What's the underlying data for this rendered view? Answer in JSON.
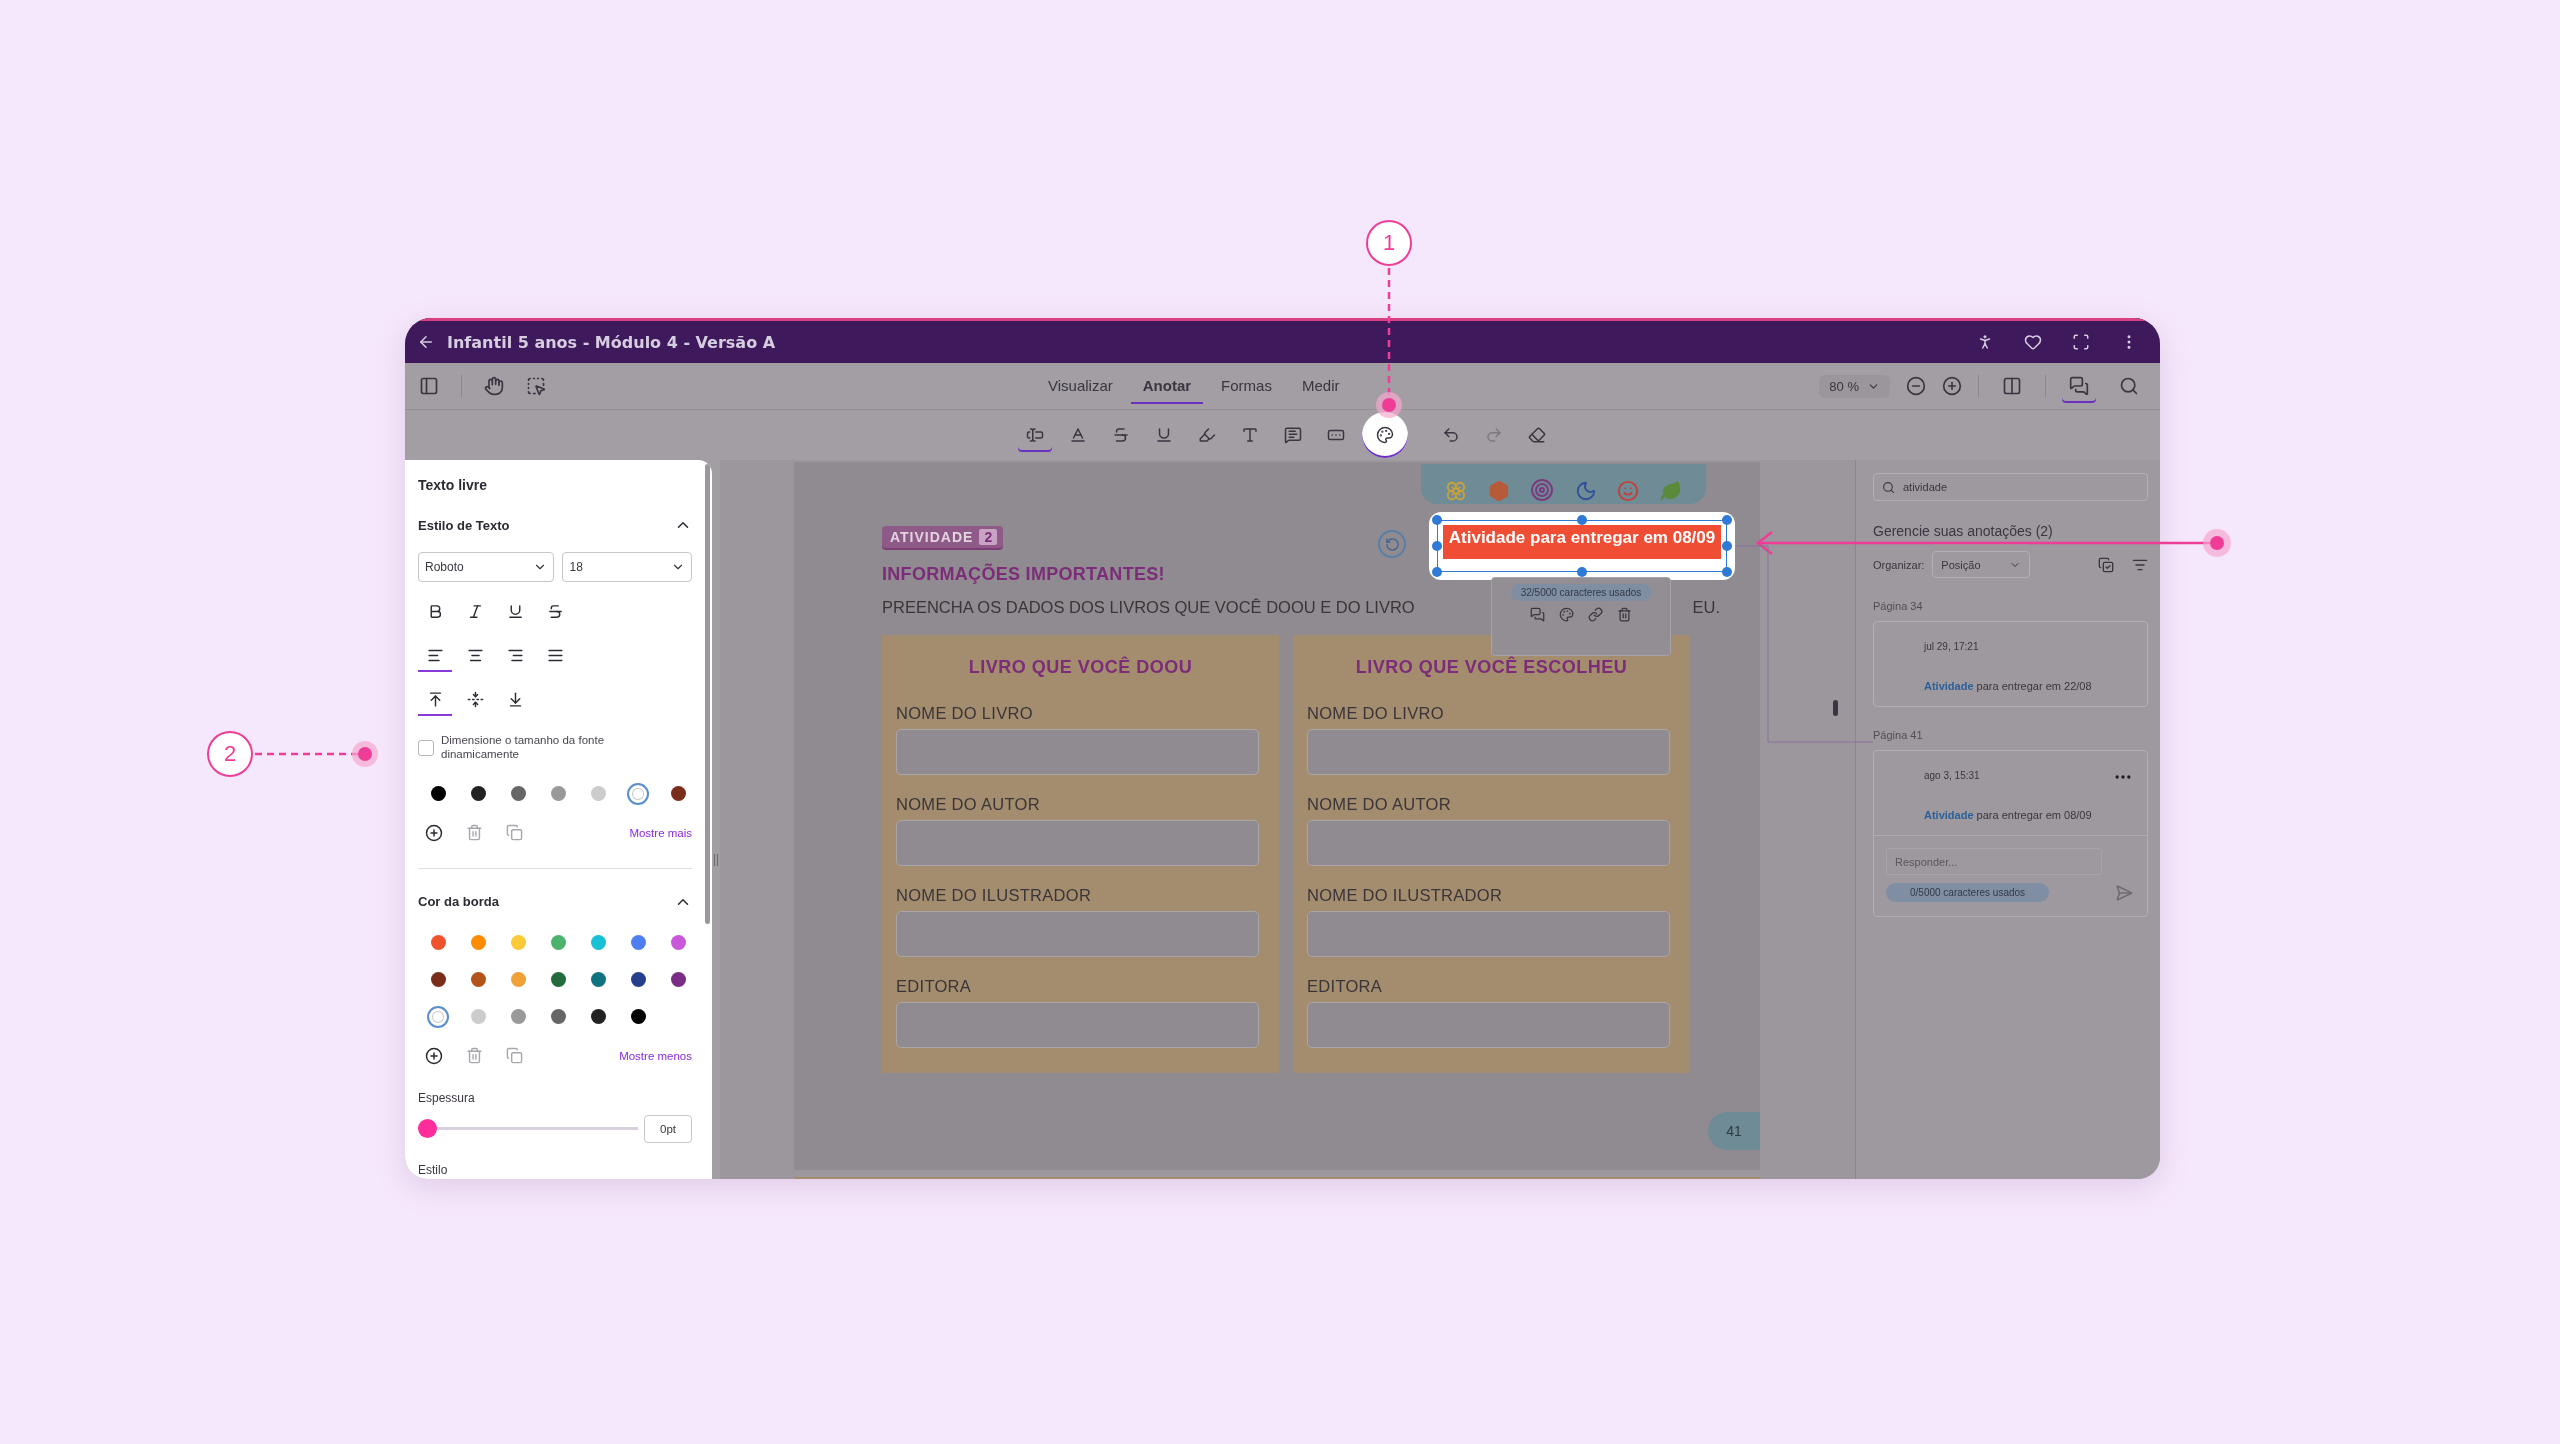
{
  "window": {
    "title": "Infantil 5 anos - Módulo 4 - Versão A"
  },
  "tabs": [
    {
      "label": "Visualizar",
      "selected": false
    },
    {
      "label": "Anotar",
      "selected": true
    },
    {
      "label": "Formas",
      "selected": false
    },
    {
      "label": "Medir",
      "selected": false
    }
  ],
  "zoom": "80 %",
  "view_buttons": [
    {
      "selected": false
    },
    {
      "selected": true
    },
    {
      "selected": false
    }
  ],
  "annotation_tools": [
    {
      "selected": true,
      "highlighted": false
    },
    {
      "selected": false,
      "highlighted": false
    },
    {
      "selected": false,
      "highlighted": false
    },
    {
      "selected": false,
      "highlighted": false
    },
    {
      "selected": false,
      "highlighted": false
    },
    {
      "selected": false,
      "highlighted": false
    },
    {
      "selected": false,
      "highlighted": false
    },
    {
      "selected": false,
      "highlighted": false
    },
    {
      "selected": true,
      "highlighted": true
    }
  ],
  "history": [
    {
      "disabled": false
    },
    {
      "disabled": true
    }
  ],
  "text_panel": {
    "title": "Texto livre",
    "text_style": {
      "title": "Estilo de Texto",
      "expanded": true,
      "font": "Roboto",
      "size": "18",
      "alignments": [
        {
          "selected": true
        },
        {
          "selected": false
        },
        {
          "selected": false
        },
        {
          "selected": false
        }
      ],
      "vertical": [
        {
          "selected": true
        },
        {
          "selected": false
        },
        {
          "selected": false
        }
      ],
      "dynamic_size": {
        "label": "Dimensione o tamanho da fonte dinamicamente",
        "checked": false
      },
      "colors": [
        {
          "color": "#000000",
          "selected": false
        },
        {
          "color": "#222222",
          "selected": false
        },
        {
          "color": "#666666",
          "selected": false
        },
        {
          "color": "#999999",
          "selected": false
        },
        {
          "color": "#cccccc",
          "selected": false
        },
        {
          "color": "#ffffff",
          "selected": true
        },
        {
          "color": "#7a2e1a",
          "selected": false
        }
      ],
      "link": "Mostre mais"
    },
    "border": {
      "title": "Cor da borda",
      "expanded": true,
      "colors": [
        {
          "color": "#f0522d",
          "selected": false
        },
        {
          "color": "#ff8c00",
          "selected": false
        },
        {
          "color": "#fcc938",
          "selected": false
        },
        {
          "color": "#4cb36c",
          "selected": false
        },
        {
          "color": "#17c0d4",
          "selected": false
        },
        {
          "color": "#4e7ef0",
          "selected": false
        },
        {
          "color": "#c957d9",
          "selected": false
        },
        {
          "color": "#7a2e1a",
          "selected": false
        },
        {
          "color": "#b5541a",
          "selected": false
        },
        {
          "color": "#f0a035",
          "selected": false
        },
        {
          "color": "#216b3d",
          "selected": false
        },
        {
          "color": "#0f7280",
          "selected": false
        },
        {
          "color": "#263f8c",
          "selected": false
        },
        {
          "color": "#7a2d85",
          "selected": false
        },
        {
          "color": "#ffffff",
          "selected": true
        },
        {
          "color": "#cccccc",
          "selected": false
        },
        {
          "color": "#999999",
          "selected": false
        },
        {
          "color": "#666666",
          "selected": false
        },
        {
          "color": "#222222",
          "selected": false
        },
        {
          "color": "#000000",
          "selected": false
        }
      ],
      "link": "Mostre menos",
      "thickness": {
        "label": "Espessura",
        "level": 0,
        "value": "0pt"
      }
    },
    "style_label": "Estilo"
  },
  "document": {
    "badge": "ATIVIDADE",
    "badge_number": "2",
    "heading": "INFORMAÇÕES IMPORTANTES!",
    "instruction": [
      "PREENCHA OS DADOS DOS LIVROS QUE VOCÊ DOOU E DO LIVRO",
      "EU."
    ],
    "cards": [
      {
        "title": "LIVRO QUE VOCÊ DOOU",
        "fields": [
          "NOME DO LIVRO",
          "NOME DO AUTOR",
          "NOME DO ILUSTRADOR",
          "EDITORA"
        ]
      },
      {
        "title": "LIVRO QUE VOCÊ ESCOLHEU",
        "fields": [
          "NOME DO LIVRO",
          "NOME DO AUTOR",
          "NOME DO ILUSTRADOR",
          "EDITORA"
        ]
      }
    ],
    "page_number": "41"
  },
  "note": {
    "text": "Atividade para entregar em 08/09",
    "counter": "32/5000 caracteres usados"
  },
  "annotations_panel": {
    "search": "atividade",
    "heading": "Gerencie suas anotações (2)",
    "sort_label": "Organizar:",
    "sort_value": "Posição",
    "groups": [
      {
        "page": "Página 34",
        "date": "jul 29, 17:21",
        "highlight": "Atividade",
        "text": "para entregar em 22/08",
        "expanded": false
      },
      {
        "page": "Página 41",
        "date": "ago 3, 15:31",
        "highlight": "Atividade",
        "text": "para entregar em 08/09",
        "expanded": true,
        "reply_placeholder": "Responder...",
        "counter": "0/5000 caracteres usados"
      }
    ]
  },
  "callouts": [
    "1",
    "2"
  ]
}
